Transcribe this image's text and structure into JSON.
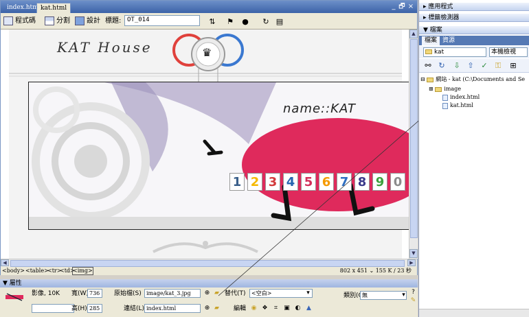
{
  "document": {
    "tabs": [
      {
        "label": "index.html",
        "active": false
      },
      {
        "label": "kat.html",
        "active": true
      }
    ],
    "window_controls": [
      "_",
      "🗗",
      "×"
    ],
    "toolbar": {
      "code_label": "程式碼",
      "split_label": "分割",
      "design_label": "設計",
      "title_label": "標題:",
      "title_value": "OT_014"
    },
    "page": {
      "logo_text": "KAT House",
      "banner_name": "name::KAT",
      "banner_numbers": [
        "1",
        "2",
        "3",
        "4",
        "5",
        "6",
        "7",
        "8",
        "9",
        "0"
      ],
      "banner_number_colors": [
        "#3a5f8a",
        "#f5b900",
        "#d23b3b",
        "#2565b0",
        "#d2305a",
        "#f59a00",
        "#2f6fc1",
        "#3a3a8a",
        "#3ca13c",
        "#8c8c8c"
      ]
    },
    "statusbar": {
      "crumbs": [
        "<body>",
        "<table>",
        "<tr>",
        "<td>",
        "<img>"
      ],
      "right": "802 x 451 ⌄ 155 K / 23 秒"
    }
  },
  "properties": {
    "header": "▼ 屬性",
    "image_label": "影像, 10K",
    "width_label": "寬(W)",
    "width_value": "736",
    "height_label": "高(H)",
    "height_value": "285",
    "src_label": "原始檔(S)",
    "src_value": "image/kat_3.jpg",
    "alt_label": "替代(T)",
    "alt_value": "<空白>",
    "link_label": "連結(L)",
    "link_value": "index.html",
    "class_label": "類別(C)",
    "class_value": "無",
    "edit_label": "編輯",
    "name_value": ""
  },
  "panels": {
    "groups": [
      "▸ 應用程式",
      "▸ 標籤檢測器",
      "▼ 檔案"
    ],
    "file_tabs": [
      {
        "label": "檔案",
        "active": true
      },
      {
        "label": "資源",
        "active": false
      }
    ],
    "site_select": "kat",
    "view_select": "本機檢視",
    "tree": [
      {
        "label": "網站 - kat (C:\\Documents and Se",
        "type": "site",
        "indent": 0
      },
      {
        "label": "image",
        "type": "folder",
        "indent": 1
      },
      {
        "label": "index.html",
        "type": "file",
        "indent": 1
      },
      {
        "label": "kat.html",
        "type": "file",
        "indent": 1
      }
    ]
  }
}
